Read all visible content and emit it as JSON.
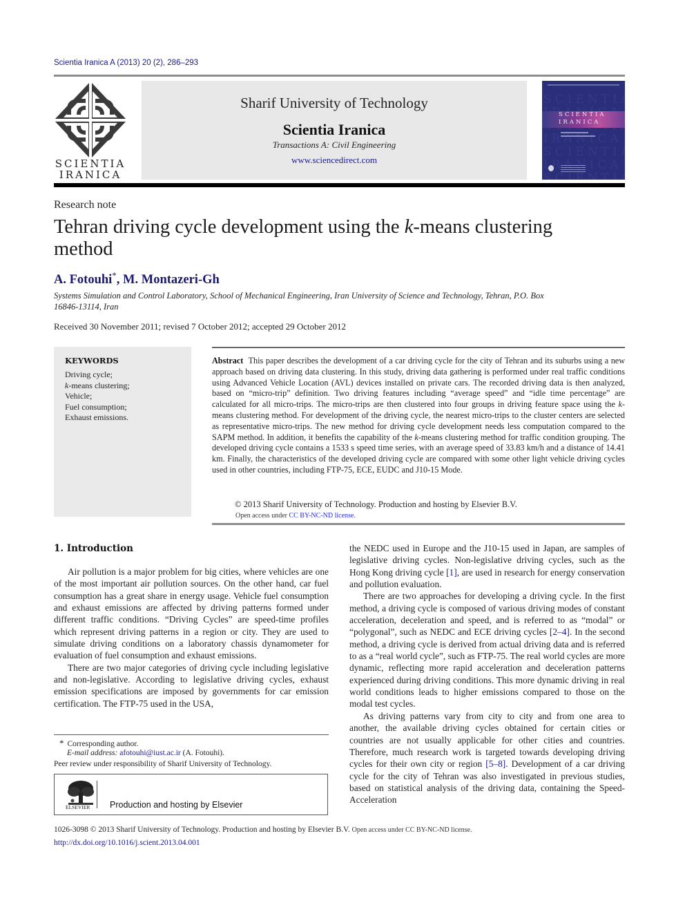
{
  "header": {
    "citation": "Scientia Iranica A (2013) 20 (2), 286–293",
    "logo_text_line1": "SCIENTIA",
    "logo_text_line2": "IRANICA",
    "university": "Sharif University of Technology",
    "journal": "Scientia Iranica",
    "transactions": "Transactions A: Civil Engineering",
    "website": "www.sciencedirect.com",
    "cover": {
      "line1": "SCIENTIA",
      "line2": "IRANICA",
      "colors": {
        "background": "#2b2f7a",
        "band": "#b9529f"
      }
    }
  },
  "article": {
    "type": "Research note",
    "title_before_italic": "Tehran driving cycle development using the ",
    "title_italic": "k",
    "title_after_italic": "-means clustering method",
    "authors": [
      {
        "name": "A. Fotouhi",
        "marker": "*"
      },
      {
        "name": "M. Montazeri-Gh",
        "marker": ""
      }
    ],
    "author_separator": ", ",
    "affiliation": "Systems Simulation and Control Laboratory, School of Mechanical Engineering, Iran University of Science and Technology, Tehran, P.O. Box 16846-13114, Iran",
    "dates": "Received 30 November 2011; revised 7 October 2012; accepted 29 October 2012"
  },
  "keywords": {
    "heading": "KEYWORDS",
    "items": [
      {
        "italic": "",
        "text": "Driving cycle;"
      },
      {
        "italic": "k",
        "text": "-means clustering;"
      },
      {
        "italic": "",
        "text": "Vehicle;"
      },
      {
        "italic": "",
        "text": "Fuel consumption;"
      },
      {
        "italic": "",
        "text": "Exhaust emissions."
      }
    ]
  },
  "abstract": {
    "label": "Abstract",
    "segments": [
      "This paper describes the development of a car driving cycle for the city of Tehran and its suburbs using a new approach based on driving data clustering. In this study, driving data gathering is performed under real traffic conditions using Advanced Vehicle Location (AVL) devices installed on private cars. The recorded driving data is then analyzed, based on “micro-trip” definition. Two driving features including “average speed” and “idle time percentage” are calculated for all micro-trips. The micro-trips are then clustered into four groups in driving feature space using the ",
      "k",
      "-means clustering method. For development of the driving cycle, the nearest micro-trips to the cluster centers are selected as representative micro-trips. The new method for driving cycle development needs less computation compared to the SAPM method. In addition, it benefits the capability of the ",
      "k",
      "-means clustering method for traffic condition grouping. The developed driving cycle contains a 1533 s speed time series, with an average speed of 33.83 km/h and a distance of 14.41 km. Finally, the characteristics of the developed driving cycle are compared with some other light vehicle driving cycles used in other countries, including FTP-75, ECE, EUDC and J10-15 Mode."
    ],
    "copyright": "© 2013 Sharif University of Technology. Production and hosting by Elsevier B.V.",
    "open_access_prefix": "Open access under ",
    "open_access_link": "CC BY-NC-ND license."
  },
  "introduction": {
    "heading": "1.  Introduction",
    "left_paragraphs": [
      "Air pollution is a major problem for big cities, where vehicles are one of the most important air pollution sources. On the other hand, car fuel consumption has a great share in energy usage. Vehicle fuel consumption and exhaust emissions are affected by driving patterns formed under different traffic conditions. “Driving Cycles” are speed-time profiles which represent driving patterns in a region or city. They are used to simulate driving conditions on a laboratory chassis dynamometer for evaluation of fuel consumption and exhaust emissions.",
      "There are two major categories of driving cycle including legislative and non-legislative. According to legislative driving cycles, exhaust emission specifications are imposed by governments for car emission certification. The FTP-75 used in the USA,"
    ],
    "right_p1_a": "the NEDC used in Europe and the J10-15 used in Japan, are samples of legislative driving cycles. Non-legislative driving cycles, such as the Hong Kong driving cycle ",
    "right_p1_ref": "[1]",
    "right_p1_b": ", are used in research for energy conservation and pollution evaluation.",
    "right_p2_a": "There are two approaches for developing a driving cycle. In the first method, a driving cycle is composed of various driving modes of constant acceleration, deceleration and speed, and is referred to as “modal” or “polygonal”, such as NEDC and ECE driving cycles ",
    "right_p2_ref": "[2–4]",
    "right_p2_b": ". In the second method, a driving cycle is derived from actual driving data and is referred to as a “real world cycle”, such as FTP-75. The real world cycles are more dynamic, reflecting more rapid acceleration and deceleration patterns experienced during driving conditions. This more dynamic driving in real world conditions leads to higher emissions compared to those on the modal test cycles.",
    "right_p3_a": "As driving patterns vary from city to city and from one area to another, the available driving cycles obtained for certain cities or countries are not usually applicable for other cities and countries. Therefore, much research work is targeted towards developing driving cycles for their own city or region ",
    "right_p3_ref": "[5–8]",
    "right_p3_b": ". Development of a car driving cycle for the city of Tehran was also investigated in previous studies, based on statistical analysis of the driving data, containing the Speed-Acceleration"
  },
  "footnotes": {
    "marker": "*",
    "corresponding": "Corresponding author.",
    "email_label": "E-mail address: ",
    "email": "afotouhi@iust.ac.ir",
    "email_suffix": " (A. Fotouhi).",
    "peer_review": "Peer review under responsibility of Sharif University of Technology.",
    "elsevier_wordmark": "ELSEVIER",
    "elsevier_text": "Production and hosting by Elsevier"
  },
  "footer": {
    "issn_copyright": "1026-3098 © 2013 Sharif University of Technology. Production and hosting by Elsevier B.V. ",
    "open_access_prefix": "Open access under ",
    "open_access_link": "CC BY-NC-ND license.",
    "doi": "http://dx.doi.org/10.1016/j.scient.2013.04.001"
  }
}
